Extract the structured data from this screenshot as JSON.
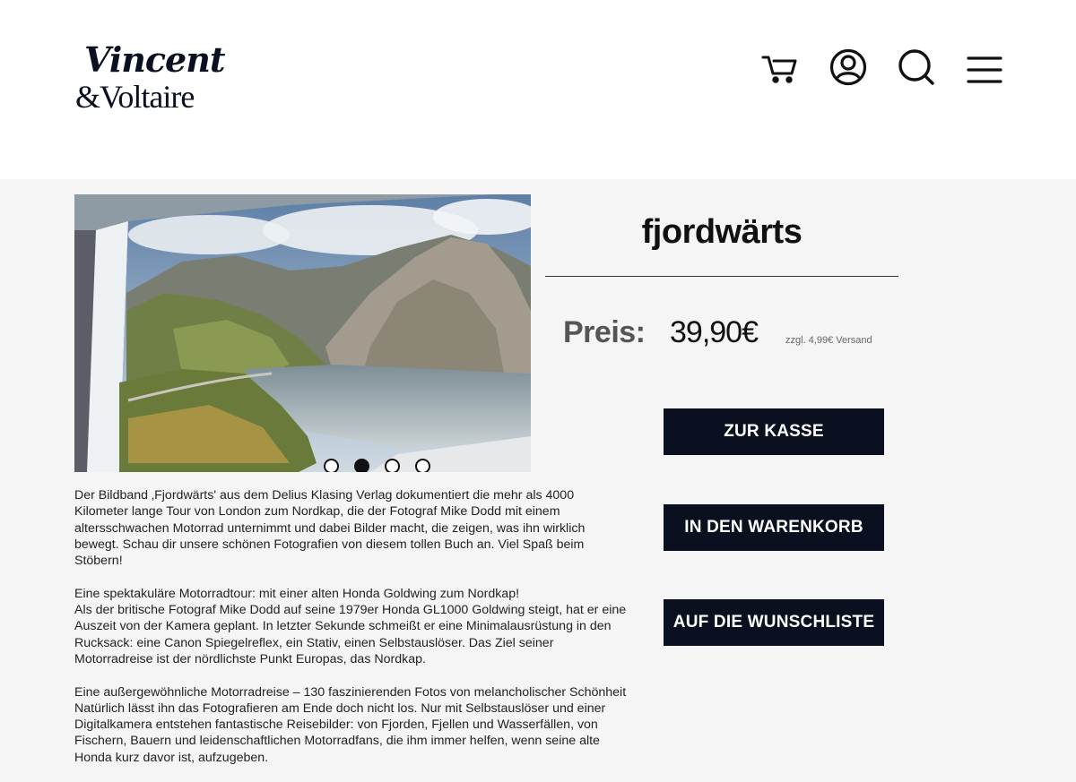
{
  "header": {
    "logo": {
      "line1": "Vincent",
      "line2": "&Voltaire"
    },
    "icons": {
      "cart": "cart-icon",
      "account": "account-icon",
      "search": "search-icon",
      "menu": "menu-icon"
    }
  },
  "product": {
    "title": "fjordwärts",
    "price_label": "Preis:",
    "price": "39,90€",
    "shipping_note": "zzgl. 4,99€ Versand",
    "gallery": {
      "slide_count": 4,
      "active_slide": 2
    }
  },
  "actions": {
    "checkout_label": "ZUR KASSE",
    "add_to_cart_label": "IN DEN WARENKORB",
    "wishlist_label": "AUF DIE WUNSCHLISTE"
  },
  "description": {
    "paragraph1": "Der Bildband ‚Fjordwärts' aus dem Delius Klasing Verlag dokumentiert die mehr als 4000 Kilometer lange Tour von London zum Nordkap, die der Fotograf Mike Dodd mit einem altersschwachen Motorrad unternimmt und dabei Bilder macht, die zeigen, was ihn wirklich bewegt. Schau dir unsere schönen Fotografien von diesem tollen Buch an. Viel Spaß beim Stöbern!",
    "paragraph2_heading": "Eine spektakuläre Motorradtour: mit einer alten Honda Goldwing zum Nordkap!",
    "paragraph2_body": "Als der britische Fotograf Mike Dodd auf seine 1979er Honda GL1000 Goldwing steigt, hat er eine Auszeit von der Kamera geplant. In letzter Sekunde schmeißt er eine Minimalausrüstung in den Rucksack: eine Canon Spiegelreflex, ein Stativ, einen Selbstauslöser. Das Ziel seiner Motorradreise ist der nördlichste Punkt Europas, das Nordkap.",
    "paragraph3_heading": "Eine außergewöhnliche Motorradreise – 130 faszinierenden Fotos von melancholischer Schönheit",
    "paragraph3_body": "Natürlich lässt ihn das Fotografieren am Ende doch nicht los. Nur mit Selbstauslöser und einer Digitalkamera entstehen fantastische Reisebilder: von Fjorden, Fjellen und Wasserfällen, von Fischern, Bauern und leidenschaftlichen Motorradfans, die ihm immer helfen, wenn seine alte Honda kurz davor ist, aufzugeben."
  },
  "colors": {
    "brand_navy": "#0a1020",
    "page_background": "#f5f5f5",
    "header_background": "#ffffff"
  }
}
